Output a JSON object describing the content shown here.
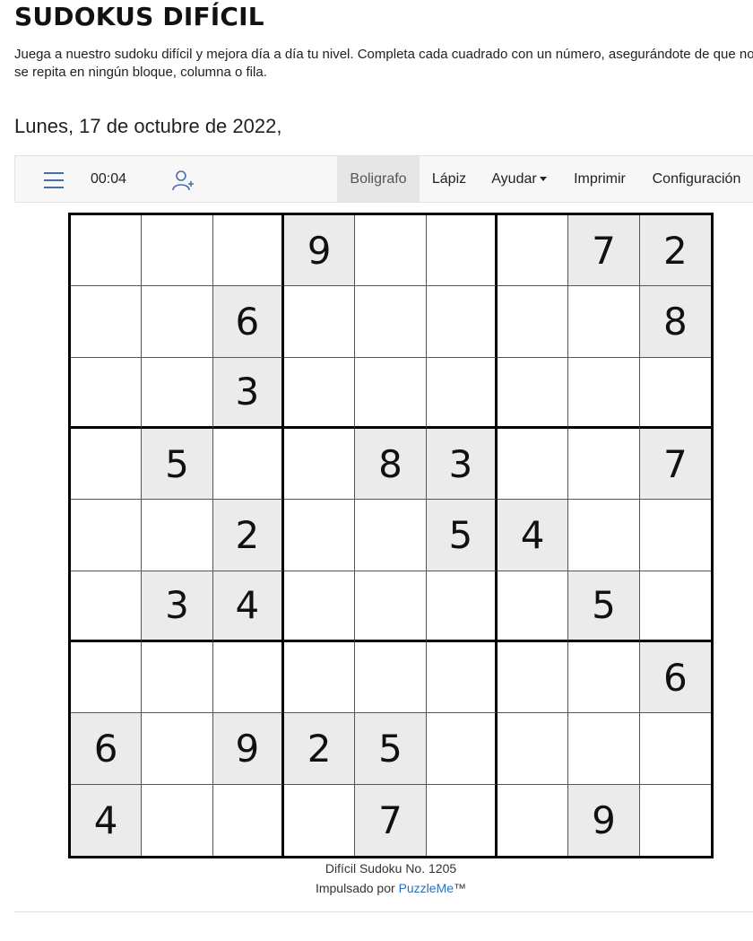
{
  "page": {
    "title": "SUDOKUS DIFÍCIL",
    "intro": "Juega a nuestro sudoku difícil y mejora día a día tu nivel. Completa cada cuadrado con un número, asegurándote de que no se repita en ningún bloque, columna o fila.",
    "date": "Lunes, 17 de octubre de 2022,"
  },
  "toolbar": {
    "menu_icon": "hamburger-menu-icon",
    "timer": "00:04",
    "add_user_icon": "add-user-icon",
    "items": [
      "Boligrafo",
      "Lápiz",
      "Ayudar",
      "Imprimir",
      "Configuración"
    ],
    "active_item": "Boligrafo",
    "accent_color": "#4a6fa5"
  },
  "board": {
    "grid": [
      [
        0,
        0,
        0,
        9,
        0,
        0,
        0,
        7,
        2
      ],
      [
        0,
        0,
        6,
        0,
        0,
        0,
        0,
        0,
        8
      ],
      [
        0,
        0,
        3,
        0,
        0,
        0,
        0,
        0,
        0
      ],
      [
        0,
        5,
        0,
        0,
        8,
        3,
        0,
        0,
        7
      ],
      [
        0,
        0,
        2,
        0,
        0,
        5,
        4,
        0,
        0
      ],
      [
        0,
        3,
        4,
        0,
        0,
        0,
        0,
        5,
        0
      ],
      [
        0,
        0,
        0,
        0,
        0,
        0,
        0,
        0,
        6
      ],
      [
        6,
        0,
        9,
        2,
        5,
        0,
        0,
        0,
        0
      ],
      [
        4,
        0,
        0,
        0,
        7,
        0,
        0,
        9,
        0
      ]
    ],
    "given_color": "#ebebeb"
  },
  "footer": {
    "puzzle_label": "Difícil Sudoku No. 1205",
    "powered_prefix": "Impulsado por",
    "powered_link": "PuzzleMe",
    "trademark": "™"
  }
}
